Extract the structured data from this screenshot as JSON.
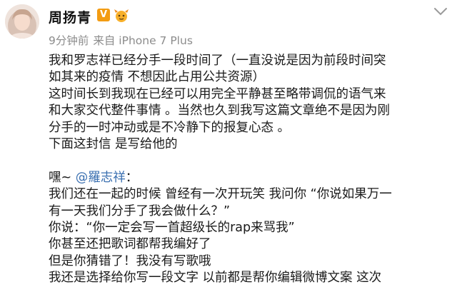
{
  "user": {
    "name": "周扬青",
    "verified_badge": "V",
    "avatar_icon": "avatar-photo",
    "face_badge_icon": "member-face-icon"
  },
  "meta": {
    "time": "9分钟前",
    "source": "来自 iPhone 7 Plus"
  },
  "post": {
    "lines": [
      "我和罗志祥已经分手一段时间了（一直没说是因为前段时间突",
      "如其来的疫情 不想因此占用公共资源）",
      "这时间长到我现在已经可以用完全平静甚至略带调侃的语气来",
      "和大家交代整件事情 。当然也久到我写这篇文章绝不是因为刚",
      "分手的一时冲动或是不冷静下的报复心态 。",
      "下面这封信 是写给他的"
    ],
    "greeting_prefix": "嘿~ ",
    "mention": "@羅志祥",
    "greeting_suffix": "：",
    "letter_lines": [
      "我们还在一起的时候 曾经有一次开玩笑 我问你 “你说如果万一",
      "有一天我们分手了我会做什么？”",
      "你说：“你一定会写一首超级长的rap来骂我”",
      "你甚至还把歌词都帮我编好了",
      "但是你猜错了！我没有写歌哦",
      "我还是选择给你写一段文字 以前都是帮你编辑微博文案 这次"
    ]
  },
  "colors": {
    "mention": "#3a6fb0",
    "badge": "#f39c12",
    "meta": "#8c8c8c"
  }
}
